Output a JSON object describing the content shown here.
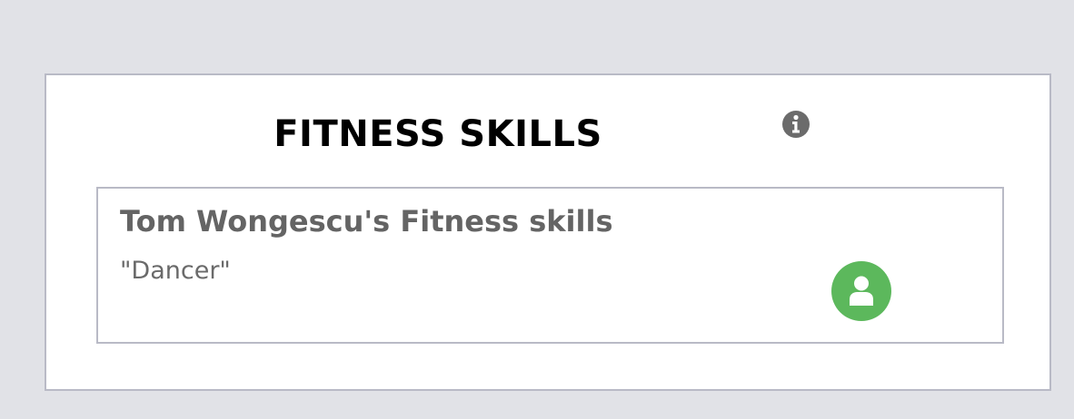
{
  "card": {
    "title": "FITNESS SKILLS",
    "info_icon": "info-icon",
    "skill": {
      "heading": "Tom Wongescu's Fitness skills",
      "value": "\"Dancer\"",
      "profile_icon": "user-icon"
    }
  },
  "colors": {
    "page_background": "#e1e2e7",
    "card_background": "#ffffff",
    "border": "#b9bac6",
    "title_text": "#000000",
    "muted_text": "#646464",
    "icon_gray": "#6b6b6b",
    "profile_button": "#5cb85c"
  }
}
